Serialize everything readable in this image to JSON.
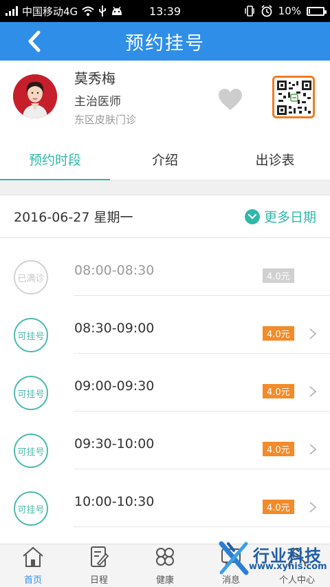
{
  "status_bar": {
    "carrier": "中国移动4G",
    "time": "13:39",
    "battery": "10%",
    "battery_level": 0.1,
    "icons": [
      "signal-icon",
      "wifi-icon",
      "usb-icon",
      "android-icon",
      "vibrate-icon",
      "alarm-icon",
      "battery-icon"
    ]
  },
  "header": {
    "title": "预约挂号",
    "back_icon": "chevron-left-icon",
    "color": "#2f8ee8"
  },
  "doctor": {
    "name": "莫秀梅",
    "title": "主治医师",
    "department": "东区皮肤门诊",
    "favorite_icon": "heart-icon",
    "qr_icon": "qr-code-icon"
  },
  "tabs": [
    {
      "label": "预约时段",
      "active": true
    },
    {
      "label": "介绍",
      "active": false
    },
    {
      "label": "出诊表",
      "active": false
    }
  ],
  "accent_color": "#2fb8a8",
  "date_bar": {
    "date": "2016-06-27 星期一",
    "more_label": "更多日期"
  },
  "slots": [
    {
      "status": "已满诊",
      "time": "08:00-08:30",
      "price": "4.0元",
      "available": false
    },
    {
      "status": "可挂号",
      "time": "08:30-09:00",
      "price": "4.0元",
      "available": true
    },
    {
      "status": "可挂号",
      "time": "09:00-09:30",
      "price": "4.0元",
      "available": true
    },
    {
      "status": "可挂号",
      "time": "09:30-10:00",
      "price": "4.0元",
      "available": true
    },
    {
      "status": "可挂号",
      "time": "10:00-10:30",
      "price": "4.0元",
      "available": true
    }
  ],
  "bottom_nav": [
    {
      "label": "首页",
      "icon": "home-icon",
      "active": true
    },
    {
      "label": "日程",
      "icon": "schedule-icon",
      "active": false
    },
    {
      "label": "健康",
      "icon": "health-icon",
      "active": false
    },
    {
      "label": "消息",
      "icon": "message-icon",
      "active": false
    },
    {
      "label": "个人中心",
      "icon": "profile-icon",
      "active": false
    }
  ],
  "watermark": {
    "text": "行业科技",
    "url": "www.xyhis.com"
  }
}
